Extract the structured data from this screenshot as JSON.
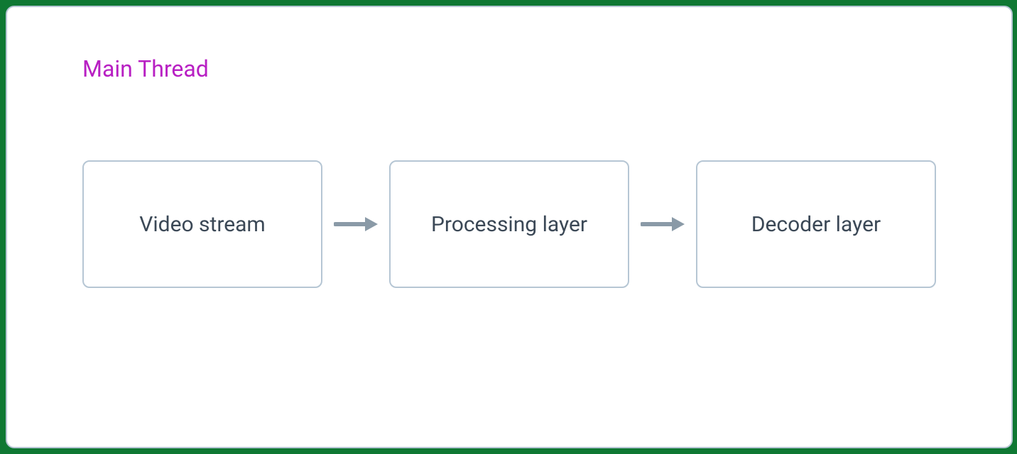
{
  "diagram": {
    "title": "Main Thread",
    "nodes": [
      {
        "label": "Video stream"
      },
      {
        "label": "Processing layer"
      },
      {
        "label": "Decoder layer"
      }
    ]
  },
  "colors": {
    "title": "#b820c3",
    "node_border": "#b6c6d4",
    "node_text": "#3b4856",
    "arrow": "#8a9aa7"
  }
}
